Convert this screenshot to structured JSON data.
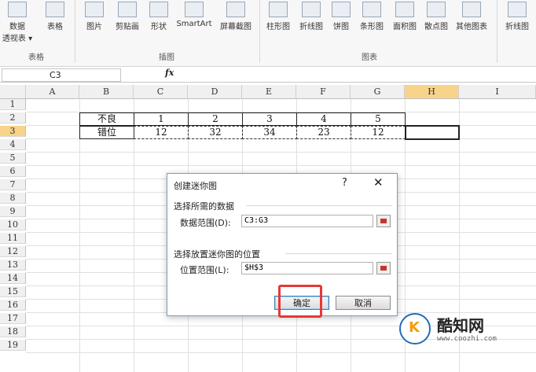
{
  "ribbon": {
    "buttons": [
      {
        "label": "数据\n透视表 ▾",
        "name": "pivot-table-button"
      },
      {
        "label": "表格",
        "name": "table-button"
      },
      {
        "label": "图片",
        "name": "picture-button"
      },
      {
        "label": "剪贴画",
        "name": "clipart-button"
      },
      {
        "label": "形状",
        "name": "shapes-button"
      },
      {
        "label": "SmartArt",
        "name": "smartart-button"
      },
      {
        "label": "屏幕截图",
        "name": "screenshot-button"
      },
      {
        "label": "柱形图",
        "name": "column-chart-button"
      },
      {
        "label": "折线图",
        "name": "line-chart-button"
      },
      {
        "label": "饼图",
        "name": "pie-chart-button"
      },
      {
        "label": "条形图",
        "name": "bar-chart-button"
      },
      {
        "label": "面积图",
        "name": "area-chart-button"
      },
      {
        "label": "散点图",
        "name": "scatter-chart-button"
      },
      {
        "label": "其他图表",
        "name": "other-charts-button"
      },
      {
        "label": "折线图",
        "name": "sparkline-line-button"
      }
    ],
    "groups": {
      "table": "表格",
      "illustrations": "插图",
      "charts": "图表"
    }
  },
  "formula_bar": {
    "name_box": "C3",
    "fx": "fx"
  },
  "columns": [
    "A",
    "B",
    "C",
    "D",
    "E",
    "F",
    "G",
    "H",
    "I"
  ],
  "rows": [
    "1",
    "2",
    "3",
    "4",
    "5",
    "6",
    "7",
    "8",
    "9",
    "10",
    "11",
    "12",
    "13",
    "14",
    "15",
    "16",
    "17",
    "18",
    "19"
  ],
  "sheet": {
    "row2": {
      "label": "不良",
      "values": [
        "1",
        "2",
        "3",
        "4",
        "5"
      ]
    },
    "row3": {
      "label": "错位",
      "values": [
        "12",
        "32",
        "34",
        "23",
        "12"
      ]
    }
  },
  "dialog": {
    "title": "创建迷你图",
    "help": "?",
    "close": "✕",
    "section_data": "选择所需的数据",
    "data_range_label": "数据范围(D):",
    "data_range_value": "C3:G3",
    "section_location": "选择放置迷你图的位置",
    "location_label": "位置范围(L):",
    "location_value": "$H$3",
    "ok": "确定",
    "cancel": "取消"
  },
  "watermark": {
    "text": "酷知网",
    "url": "www.coozhi.com",
    "logo_letter": "K"
  }
}
